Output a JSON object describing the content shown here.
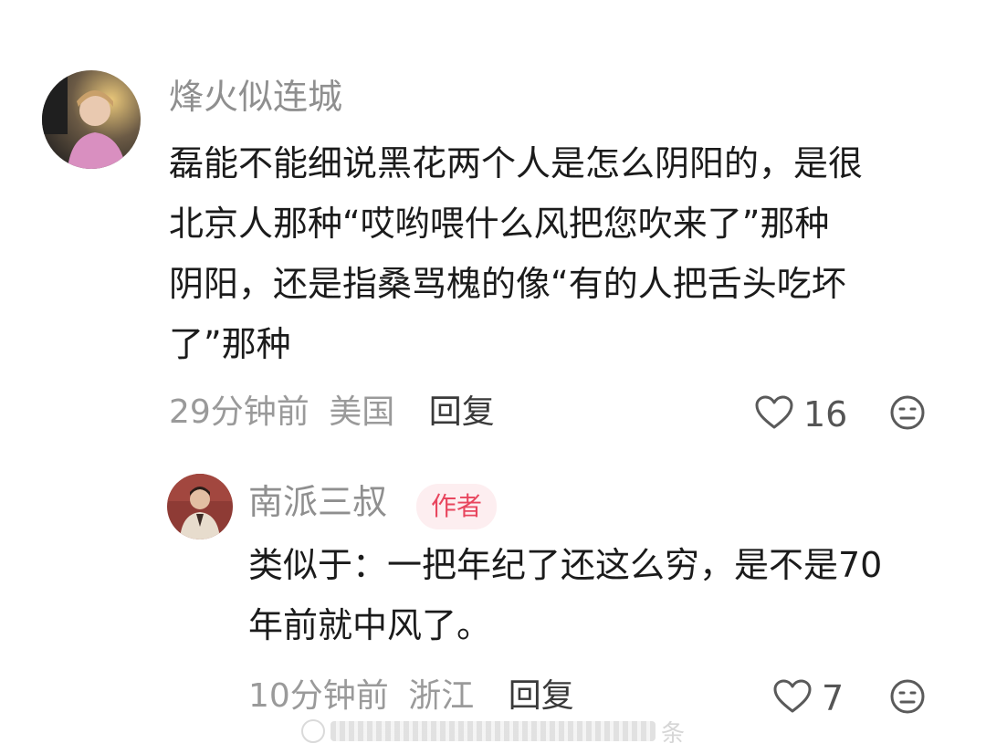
{
  "comment": {
    "username": "烽火似连城",
    "lines": [
      "磊能不能细说黑花两个人是怎么阴阳的，是很",
      "北京人那种“哎哟喂什么风把您吹来了”那种",
      "阴阳，还是指桑骂槐的像“有的人把舌头吃坏",
      "了”那种"
    ],
    "time": "29分钟前",
    "location": "美国",
    "reply_label": "回复",
    "like_count": "16"
  },
  "reply": {
    "username": "南派三叔",
    "badge": "作者",
    "lines": [
      "类似于：一把年纪了还这么穷，是不是70",
      "年前就中风了。"
    ],
    "time": "10分钟前",
    "location": "浙江",
    "reply_label": "回复",
    "like_count": "7"
  },
  "watermark": {
    "text": "条"
  },
  "colors": {
    "badge_bg": "#fdeef0",
    "badge_text": "#e8465e",
    "meta_text": "#9a9a9a",
    "username_text": "#8f8f8f"
  },
  "icons": {
    "like": "heart-outline-icon",
    "emoji": "emoji-face-icon"
  }
}
